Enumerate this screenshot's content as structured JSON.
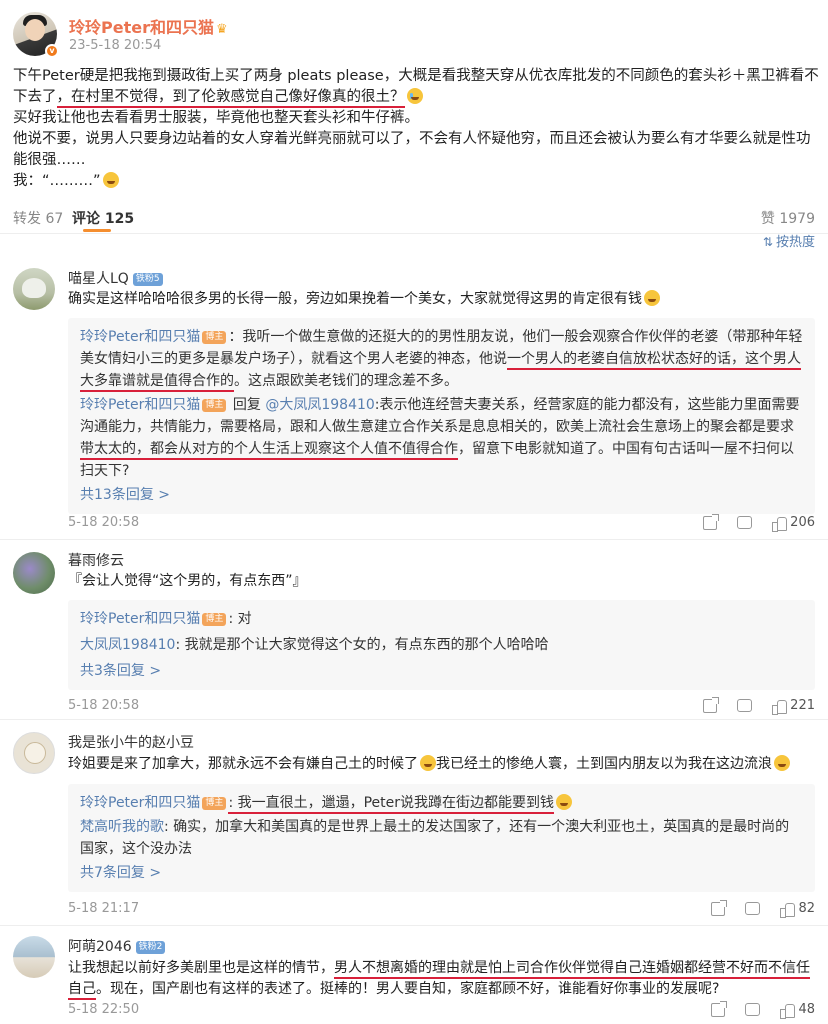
{
  "post": {
    "author": "玲玲Peter和四只猫",
    "time": "23-5-18 20:54",
    "p1_a": "下午Peter硬是把我拖到摄政街上买了两身 pleats please，大概是看我整天穿从优衣库批发的不同颜色的套头衫＋黑卫裤看不下去了",
    "p1_b": "，在村里不觉得，到了伦敦感觉自己像好像真的很土？",
    "p2": "买好我让他也去看看男士服装，毕竟他也整天套头衫和牛仔裤。",
    "p3": "他说不要，说男人只要身边站着的女人穿着光鲜亮丽就可以了，不会有人怀疑他穷，而且还会被认为要么有才华要么就是性功能很强……",
    "p4": "我：“………”"
  },
  "tabs": {
    "repost": "转发 67",
    "comment": "评论 125",
    "like": "赞 1979"
  },
  "sort": "按热度",
  "comments": [
    {
      "name": "喵星人LQ",
      "tag": "铁粉5",
      "text": "确实是这样哈哈哈很多男的长得一般，旁边如果挽着一个美女，大家就觉得这男的肯定很有钱",
      "replies": [
        {
          "name": "玲玲Peter和四只猫",
          "host": "博主",
          "a": "：我听一个做生意做的还挺大的的男性朋友说，他们一般会观察合作伙伴的老婆（带那种年轻美女情妇小三的更多是暴发户场子），就看这个男人老婆的神态，他说",
          "b": "一个男人的老婆自信放松状态好的话，这个男人大多靠谱就是值得合作的",
          "c": "。这点跟欧美老钱们的理念差不多。"
        },
        {
          "name": "玲玲Peter和四只猫",
          "host": "博主",
          "mid": " 回复 ",
          "to": "@大凤凤198410",
          "a": ":表示他连经营夫妻关系，经营家庭的能力都没有，这些能力里面需要沟通能力，共情能力，需要格局，跟和人做生意建立合作关系是息息相关的，欧美上流社会生意场上的聚会都是要求",
          "b": "带太太的，都会从对方的个人生活上观察这个人值不值得合作",
          "c": "，留意下电影就知道了。中国有句古话叫一屋不扫何以扫天下?"
        }
      ],
      "more": "共13条回复 >",
      "time": "5-18 20:58",
      "likes": "206"
    },
    {
      "name": "暮雨修云",
      "text": "『会让人觉得“这个男的，有点东西”』",
      "replies": [
        {
          "name": "玲玲Peter和四只猫",
          "host": "博主",
          "a": ": 对"
        },
        {
          "name": "大凤凤198410",
          "a": ": 我就是那个让大家觉得这个女的，有点东西的那个人哈哈哈"
        }
      ],
      "more": "共3条回复 >",
      "time": "5-18 20:58",
      "likes": "221"
    },
    {
      "name": "我是张小牛的赵小豆",
      "text_a": "玲姐要是来了加拿大，那就永远不会有嫌自己土的时候了",
      "text_b": "我已经土的惨绝人寰，土到国内朋友以为我在这边流浪",
      "replies": [
        {
          "name": "玲玲Peter和四只猫",
          "host": "博主",
          "a": ": 我一直很土，邋遢，Peter说我蹲在街边都能要到钱"
        },
        {
          "name": "梵高听我的歌",
          "a": ": 确实，加拿大和美国真的是世界上最土的发达国家了，还有一个澳大利亚也土，英国真的是最时尚的国家，这个没办法"
        }
      ],
      "more": "共7条回复 >",
      "time": "5-18 21:17",
      "likes": "82"
    },
    {
      "name": "阿萌2046",
      "tag": "铁粉2",
      "a": "让我想起以前好多美剧里也是这样的情节，",
      "b": "男人不想离婚的理由就是怕上司合作伙伴觉得自己连婚姻都经营不好而不信任自己",
      "c": "。现在，国产剧也有这样的表述了。挺棒的！男人要自知，家庭都顾不好，谁能看好你事业的发展呢?",
      "time": "5-18 22:50",
      "likes": "48"
    }
  ],
  "colors": {
    "author_orange": "#eb7350",
    "link_blue": "#587fb0",
    "highlight_red": "#d8203a",
    "tab_underline": "#f58e2f"
  }
}
